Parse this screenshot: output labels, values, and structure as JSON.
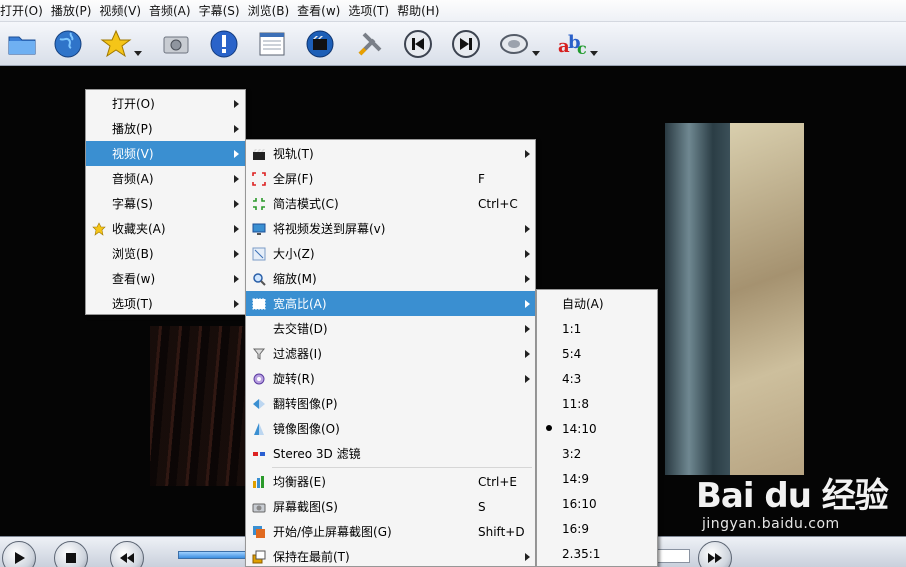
{
  "menubar": {
    "items": [
      "打开(O)",
      "播放(P)",
      "视频(V)",
      "音频(A)",
      "字幕(S)",
      "浏览(B)",
      "查看(w)",
      "选项(T)",
      "帮助(H)"
    ]
  },
  "toolbar": {
    "icons": [
      "folder-icon",
      "globe-icon",
      "favorites-star-icon",
      "camera-screenshot-icon",
      "info-icon",
      "playlist-icon",
      "video-settings-icon",
      "tools-icon",
      "previous-icon",
      "next-icon",
      "audio-icon",
      "subtitle-abc-icon"
    ]
  },
  "main_menu": {
    "items": [
      {
        "label": "打开(O)",
        "submenu": true
      },
      {
        "label": "播放(P)",
        "submenu": true
      },
      {
        "label": "视频(V)",
        "submenu": true,
        "highlighted": true
      },
      {
        "label": "音频(A)",
        "submenu": true
      },
      {
        "label": "字幕(S)",
        "submenu": true
      },
      {
        "label": "收藏夹(A)",
        "submenu": true,
        "icon": "star-icon"
      },
      {
        "label": "浏览(B)",
        "submenu": true
      },
      {
        "label": "查看(w)",
        "submenu": true
      },
      {
        "label": "选项(T)",
        "submenu": true
      }
    ]
  },
  "video_menu": {
    "items": [
      {
        "label": "视轨(T)",
        "submenu": true,
        "icon": "clapper-icon",
        "shortcut": ""
      },
      {
        "label": "全屏(F)",
        "submenu": false,
        "icon": "fullscreen-icon",
        "shortcut": "F"
      },
      {
        "label": "简洁模式(C)",
        "submenu": false,
        "icon": "compact-mode-icon",
        "shortcut": "Ctrl+C"
      },
      {
        "label": "将视频发送到屏幕(v)",
        "submenu": true,
        "icon": "monitor-icon",
        "shortcut": ""
      },
      {
        "label": "大小(Z)",
        "submenu": true,
        "icon": "resize-icon",
        "shortcut": ""
      },
      {
        "label": "缩放(M)",
        "submenu": true,
        "icon": "zoom-icon",
        "shortcut": ""
      },
      {
        "label": "宽高比(A)",
        "submenu": true,
        "icon": "aspect-ratio-icon",
        "shortcut": "",
        "highlighted": true
      },
      {
        "label": "去交错(D)",
        "submenu": true,
        "icon": "",
        "shortcut": ""
      },
      {
        "label": "过滤器(I)",
        "submenu": true,
        "icon": "filter-icon",
        "shortcut": ""
      },
      {
        "label": "旋转(R)",
        "submenu": true,
        "icon": "rotate-icon",
        "shortcut": ""
      },
      {
        "label": "翻转图像(P)",
        "submenu": false,
        "icon": "flip-icon",
        "shortcut": ""
      },
      {
        "label": "镜像图像(O)",
        "submenu": false,
        "icon": "mirror-icon",
        "shortcut": ""
      },
      {
        "label": "Stereo 3D 滤镜",
        "submenu": false,
        "icon": "stereo-3d-icon",
        "shortcut": ""
      },
      {
        "label": "均衡器(E)",
        "submenu": false,
        "icon": "equalizer-icon",
        "shortcut": "Ctrl+E"
      },
      {
        "label": "屏幕截图(S)",
        "submenu": false,
        "icon": "screenshot-icon",
        "shortcut": "S"
      },
      {
        "label": "开始/停止屏幕截图(G)",
        "submenu": false,
        "icon": "multi-screenshot-icon",
        "shortcut": "Shift+D"
      },
      {
        "label": "保持在最前(T)",
        "submenu": true,
        "icon": "on-top-icon",
        "shortcut": ""
      }
    ]
  },
  "aspect_menu": {
    "items": [
      {
        "label": "自动(A)",
        "checked": false
      },
      {
        "label": "1:1",
        "checked": false
      },
      {
        "label": "5:4",
        "checked": false
      },
      {
        "label": "4:3",
        "checked": false
      },
      {
        "label": "11:8",
        "checked": false
      },
      {
        "label": "14:10",
        "checked": true
      },
      {
        "label": "3:2",
        "checked": false
      },
      {
        "label": "14:9",
        "checked": false
      },
      {
        "label": "16:10",
        "checked": false
      },
      {
        "label": "16:9",
        "checked": false
      },
      {
        "label": "2.35:1",
        "checked": false
      }
    ]
  },
  "watermark": {
    "logo": "Bai du 经验",
    "url": "jingyan.baidu.com"
  },
  "colors": {
    "highlight": "#3a8fd1",
    "menu_bg": "#f5f5f5"
  }
}
